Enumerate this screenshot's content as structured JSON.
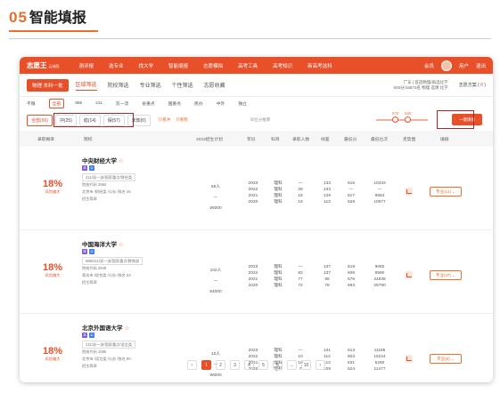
{
  "doc": {
    "number": "05",
    "title": "智能填报"
  },
  "nav": {
    "logo": "志愿王",
    "logo_sub": "云端版",
    "items": [
      "测评报",
      "选专业",
      "找大学",
      "智能填报",
      "志愿模拟",
      "高考工具",
      "高考知识",
      "新高考选科"
    ],
    "right_items": [
      "会员",
      "用户",
      "退出"
    ]
  },
  "subbar": {
    "province": "物理 本科一批",
    "tabs": [
      "区域筛选",
      "院校筛选",
      "专业筛选",
      "个性筛选",
      "志愿收藏"
    ],
    "active_tab": 0,
    "user_info_1": "广东 | 首选物理/再选化学",
    "user_info_2": "600分/15873名 物理 选课 化学",
    "plan_label": "志愿方案",
    "plan_count": "0"
  },
  "years": [
    "不限",
    "全部",
    "985",
    "211",
    "双一流",
    "省重点",
    "国重点",
    "民办",
    "中外",
    "独立"
  ],
  "filters": {
    "chips": [
      "全部(96)",
      "冲(25)",
      "稳(14)",
      "保(57)",
      "未知(0)"
    ],
    "active_chip": 0,
    "link1": "只看冲",
    "link2": "只看稳",
    "muted": "同位分推算",
    "slider_min": "570",
    "slider_max": "620",
    "button": "一键填报"
  },
  "table": {
    "headers": [
      "录取概率",
      "院校",
      "2023招生计划",
      "年份",
      "科目",
      "录取人数",
      "线差",
      "最低分",
      "最低位次",
      "走势图",
      "填报"
    ],
    "rows": [
      {
        "prob": "18%",
        "prob_label": "风险偏大",
        "name": "中央财经大学",
        "desc1": "211/双一流/国家重点/财经类",
        "desc2": "院校代码 2984",
        "desc3": "北京市 /财经类 /公办 /排名 46",
        "desc4": "招生简章",
        "plan": "58人",
        "plan_fee": "¥5000",
        "years": [
          "2023",
          "2022",
          "2021",
          "2020"
        ],
        "subjects": [
          "理科",
          "理科",
          "理科",
          "理科"
        ],
        "admits": [
          "—",
          "28",
          "16",
          "19"
        ],
        "diffs": [
          "133",
          "133",
          "129",
          "113"
        ],
        "mins": [
          "615",
          "—",
          "617",
          "628"
        ],
        "ranks": [
          "10333",
          "—",
          "9584",
          "10077"
        ],
        "major": "专业(14)"
      },
      {
        "prob": "18%",
        "prob_label": "风险偏大",
        "name": "中国海洋大学",
        "desc1": "985/211/双一流/国家重点/教育部",
        "desc2": "院校代码 2948",
        "desc3": "青岛市 /综合类 /公办 /排名 62",
        "desc4": "招生简章",
        "plan": "102人",
        "plan_fee": "¥4000",
        "years": [
          "2023",
          "2022",
          "2021",
          "2020"
        ],
        "subjects": [
          "理科",
          "理科",
          "理科",
          "理科"
        ],
        "admits": [
          "—",
          "83",
          "77",
          "72"
        ],
        "diffs": [
          "137",
          "137",
          "86",
          "78"
        ],
        "mins": [
          "619",
          "608",
          "576",
          "593"
        ],
        "ranks": [
          "9082",
          "8590",
          "24838",
          "25790"
        ],
        "major": "专业(37)"
      },
      {
        "prob": "18%",
        "prob_label": "风险偏大",
        "name": "北京外国语大学",
        "desc1": "211/双一流/国家重点/语言类",
        "desc2": "院校代码 1065",
        "desc3": "北京市 /语言类 /公办 /排名 80",
        "desc4": "招生简章",
        "plan": "10人",
        "plan_fee": "¥6000",
        "years": [
          "2023",
          "2022",
          "2021",
          "2020"
        ],
        "subjects": [
          "理科",
          "理科",
          "理科",
          "理科"
        ],
        "admits": [
          "—",
          "10",
          "10",
          "7"
        ],
        "diffs": [
          "131",
          "112",
          "113",
          "109"
        ],
        "mins": [
          "613",
          "603",
          "631",
          "624"
        ],
        "ranks": [
          "11185",
          "15224",
          "5260",
          "11477"
        ],
        "major": "专业(9)"
      }
    ]
  },
  "pager": [
    "‹",
    "1",
    "2",
    "3",
    "4",
    "5",
    "6",
    "...",
    "10",
    "›"
  ],
  "pager_active": 1
}
